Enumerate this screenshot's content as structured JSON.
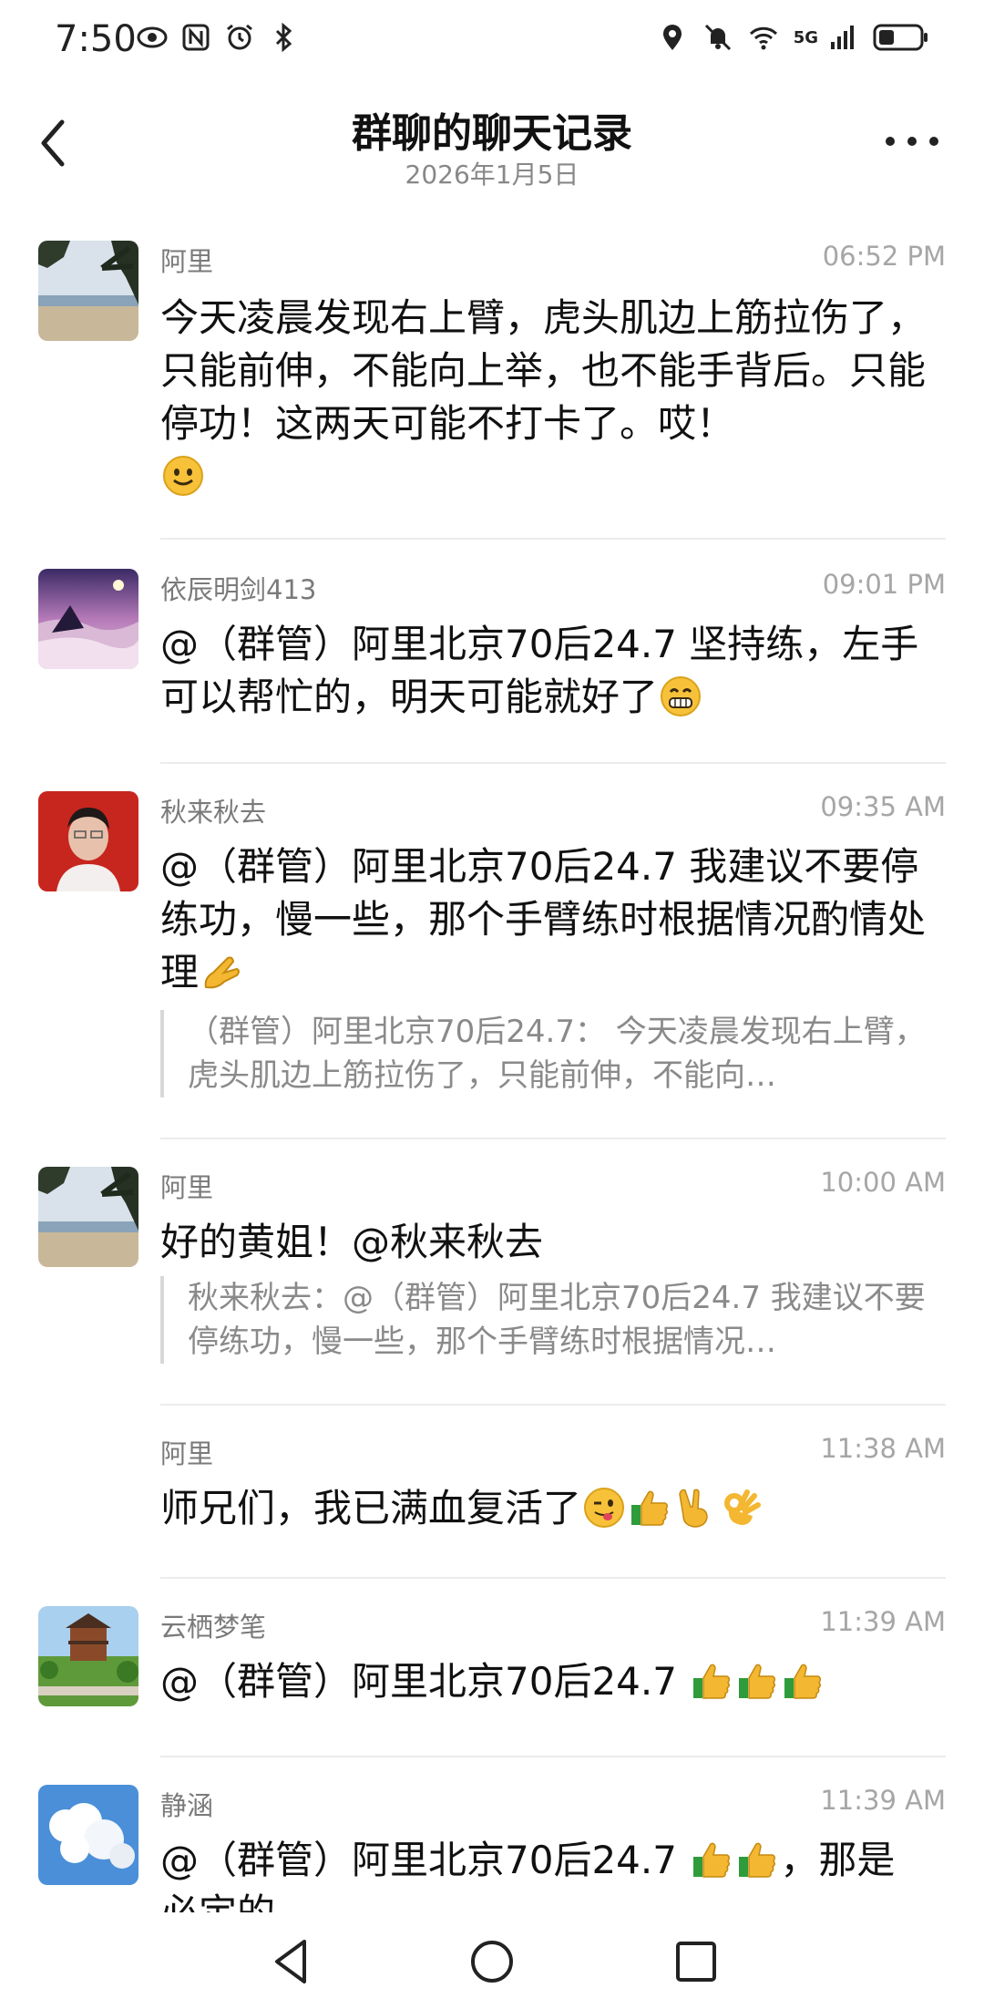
{
  "status_bar": {
    "time": "7:50",
    "network": "5G"
  },
  "header": {
    "title": "群聊的聊天记录",
    "subtitle": "2026年1月5日"
  },
  "messages": [
    {
      "name": "阿里",
      "time": "06:52 PM",
      "text": "今天凌晨发现右上臂，虎头肌边上筋拉伤了，只能前伸，不能向上举，也不能手背后。只能停功！这两天可能不打卡了。哎！"
    },
    {
      "name": "依辰明剑413",
      "time": "09:01 PM",
      "text": "@（群管）阿里北京70后24.7 坚持练，左手可以帮忙的，明天可能就好了"
    },
    {
      "name": "秋来秋去",
      "time": "09:35 AM",
      "text": "@（群管）阿里北京70后24.7 我建议不要停练功，慢一些，那个手臂练时根据情况酌情处理",
      "quote": "（群管）阿里北京70后24.7：  今天凌晨发现右上臂，虎头肌边上筋拉伤了，只能前伸，不能向…"
    },
    {
      "name": "阿里",
      "time": "10:00 AM",
      "text": "好的黄姐！@秋来秋去",
      "quote": "秋来秋去：@（群管）阿里北京70后24.7 我建议不要停练功，慢一些，那个手臂练时根据情况…"
    },
    {
      "name": "阿里",
      "time": "11:38 AM",
      "text": "师兄们，我已满血复活了"
    },
    {
      "name": "云栖梦笔",
      "time": "11:39 AM",
      "text": "@（群管）阿里北京70后24.7 "
    },
    {
      "name": "静涵",
      "time": "11:39 AM",
      "text_a": "@（群管）阿里北京70后24.7 ",
      "text_b": "，那是",
      "text_c": "必定的"
    }
  ],
  "colors": {
    "name": "#7a7a7a",
    "time": "#a6a6a6",
    "divider": "#ececec"
  },
  "icons": {
    "back": "chevron-left-icon",
    "more": "more-dots-icon",
    "nav": [
      "nav-back-icon",
      "nav-home-icon",
      "nav-recents-icon"
    ]
  }
}
